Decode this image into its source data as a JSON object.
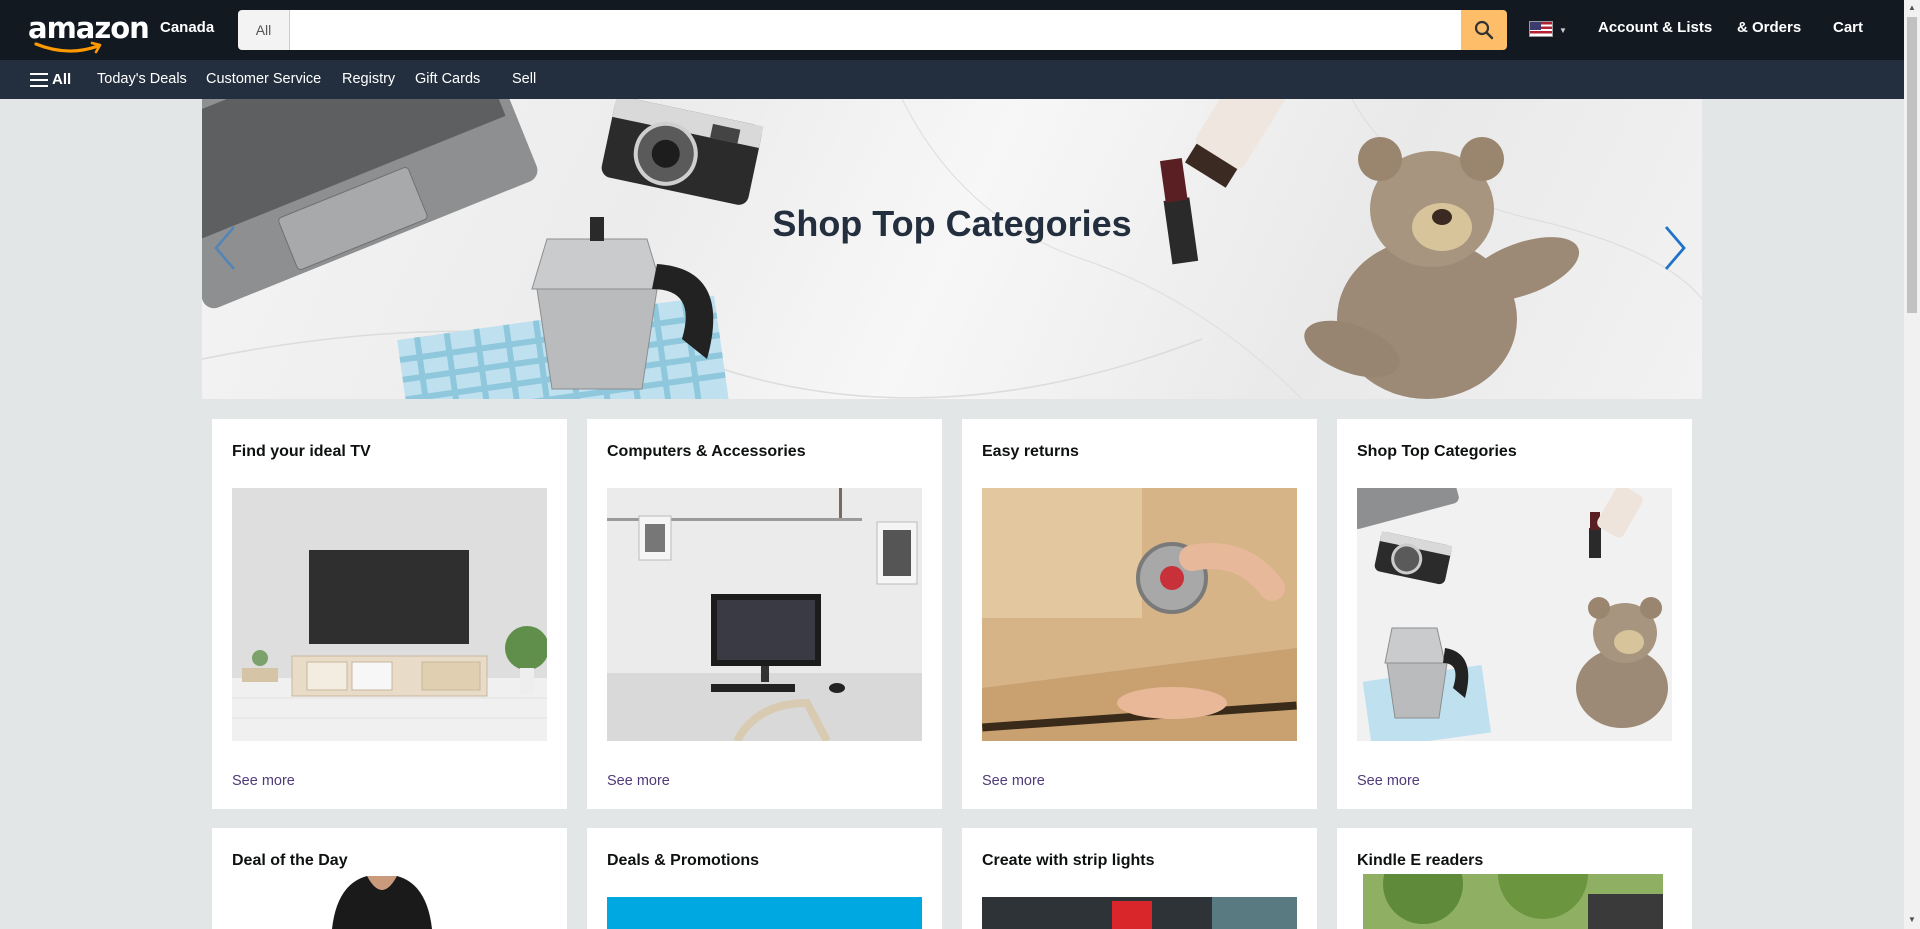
{
  "header": {
    "logo_text": "amazon",
    "locale": "Canada",
    "search": {
      "category": "All",
      "placeholder": "",
      "value": ""
    },
    "links": {
      "account": "Account & Lists",
      "orders": "& Orders",
      "cart": "Cart"
    }
  },
  "subnav": {
    "all_label": "All",
    "items": [
      "Today's Deals",
      "Customer Service",
      "Registry",
      "Gift Cards",
      "Sell"
    ]
  },
  "hero": {
    "title": "Shop Top Categories"
  },
  "cards_row1": [
    {
      "title": "Find your ideal TV",
      "link": "See more"
    },
    {
      "title": "Computers & Accessories",
      "link": "See more"
    },
    {
      "title": "Easy returns",
      "link": "See more"
    },
    {
      "title": "Shop Top Categories",
      "link": "See more"
    }
  ],
  "cards_row2": [
    {
      "title": "Deal of the Day"
    },
    {
      "title": "Deals & Promotions"
    },
    {
      "title": "Create with strip lights"
    },
    {
      "title": "Kindle E readers"
    }
  ],
  "colors": {
    "nav_top": "#131921",
    "nav_sub": "#232f3e",
    "search_button": "#febd69",
    "accent": "#ff9900",
    "page_bg": "#e3e6e6"
  }
}
